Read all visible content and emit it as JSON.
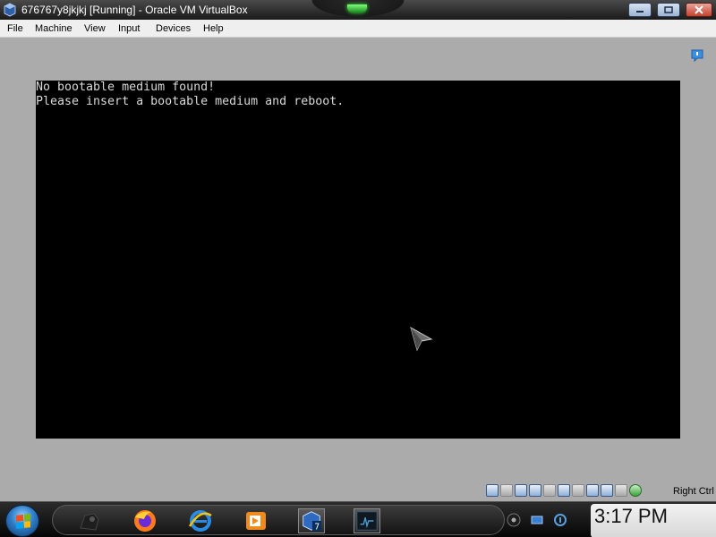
{
  "window": {
    "title": "676767y8jkjkj [Running] - Oracle VM VirtualBox"
  },
  "menu": {
    "file": "File",
    "machine": "Machine",
    "view": "View",
    "input": "Input",
    "devices": "Devices",
    "help": "Help"
  },
  "vm_screen": {
    "line1": "No bootable medium found!",
    "line2": "Please insert a bootable medium and reboot."
  },
  "statusbar": {
    "icons": [
      "hard-disk-icon",
      "optical-drive-icon",
      "audio-icon",
      "network-icon",
      "usb-icon",
      "shared-folders-icon",
      "display-icon",
      "video-capture-icon",
      "cpu-icon",
      "mouse-integration-icon",
      "host-key-icon"
    ],
    "host_key": "Right Ctrl"
  },
  "taskbar": {
    "clock": "3:17 PM",
    "apps": [
      "steam-icon",
      "firefox-icon",
      "internet-explorer-icon",
      "media-player-icon",
      "virtualbox-icon",
      "terminal-icon"
    ]
  },
  "colors": {
    "accent": "#3a7fd0",
    "vm_background": "#000000",
    "console_text": "#d9d9d9",
    "host_background": "#ababab"
  }
}
